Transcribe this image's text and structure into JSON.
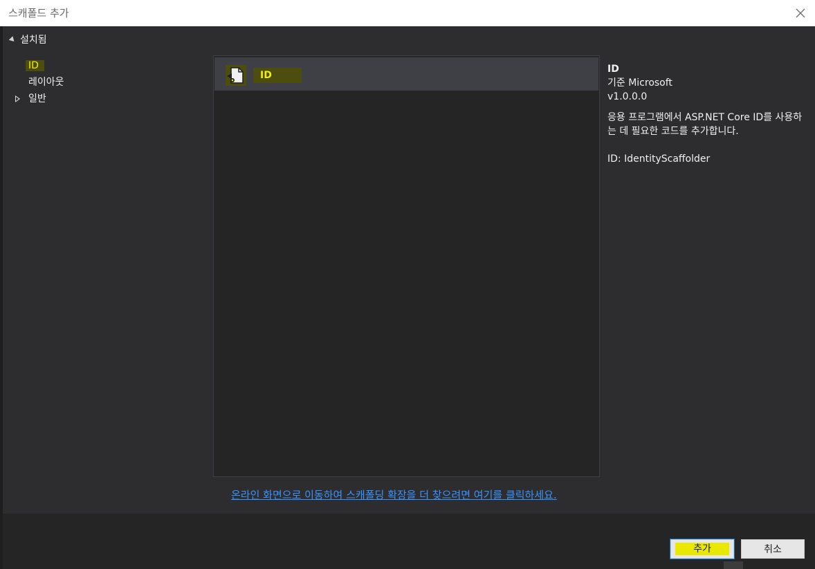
{
  "window": {
    "title": "스캐폴드 추가"
  },
  "sidebar": {
    "header": "설치됨",
    "items": [
      {
        "label": "ID",
        "selected": true
      },
      {
        "label": "레이아웃",
        "selected": false
      },
      {
        "label": "일반",
        "selected": false,
        "expandable": true
      }
    ]
  },
  "list": {
    "items": [
      {
        "label": "ID",
        "icon": "scaffold-identity-icon"
      }
    ]
  },
  "details": {
    "title": "ID",
    "author": "기준 Microsoft",
    "version": "v1.0.0.0",
    "description": "응용 프로그램에서 ASP.NET Core ID를 사용하는 데 필요한 코드를 추가합니다.",
    "id_line": "ID: IdentityScaffolder"
  },
  "online_link": "온라인 화면으로 이동하여 스캐폴딩 확장을 더 찾으려면 여기를 클릭하세요.",
  "buttons": {
    "add": "추가",
    "cancel": "취소"
  },
  "colors": {
    "highlight": "#f0f000",
    "link": "#3794ff",
    "panel": "#252526",
    "background": "#2d2d30"
  }
}
